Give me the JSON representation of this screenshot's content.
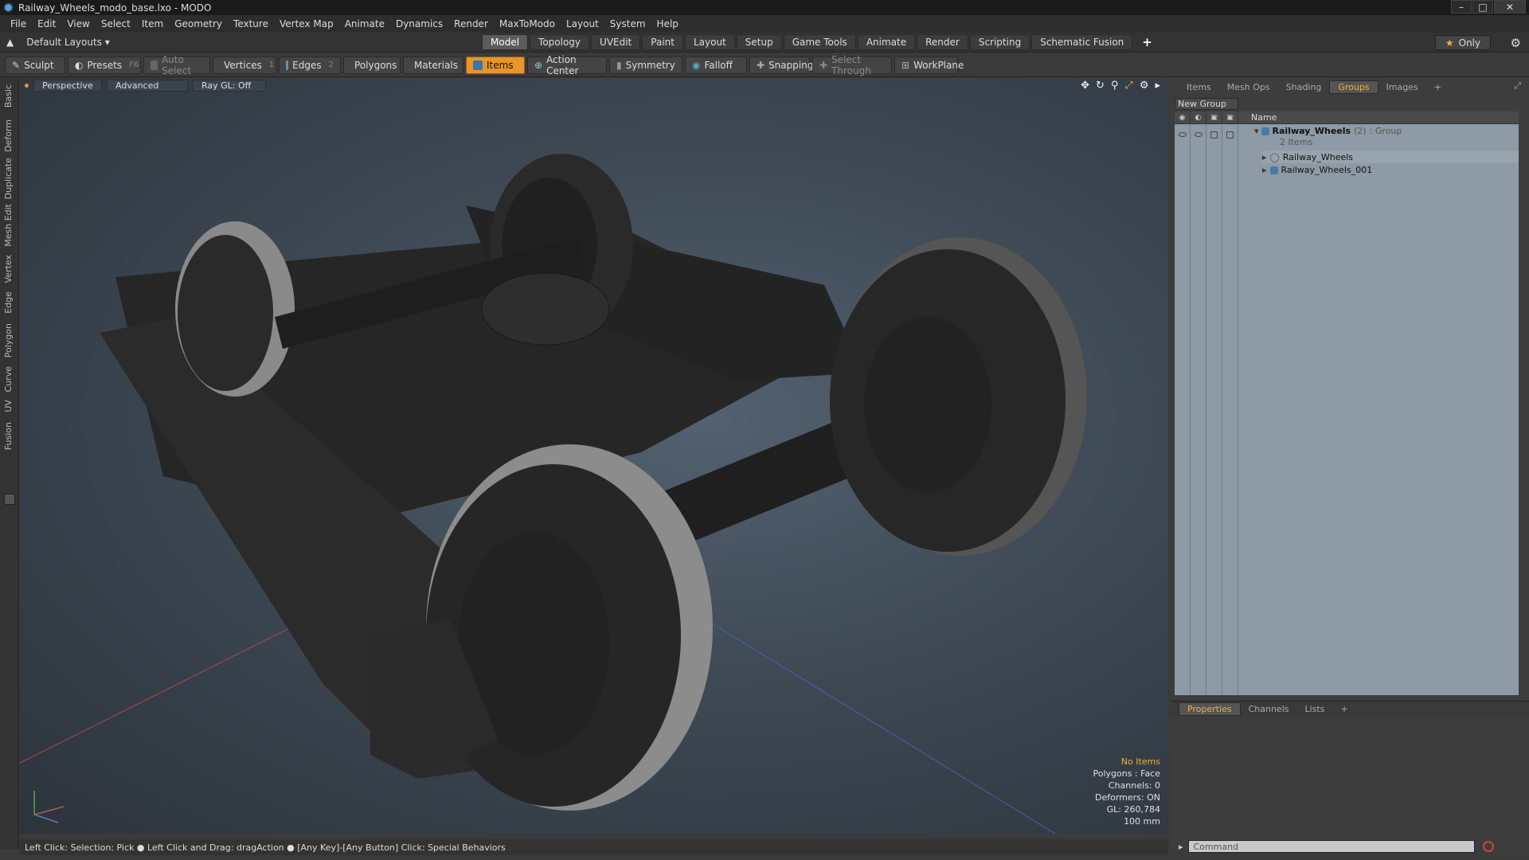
{
  "window": {
    "title": "Railway_Wheels_modo_base.lxo - MODO",
    "buttons": {
      "minimize": "–",
      "maximize": "□",
      "close": "✕"
    }
  },
  "menu": [
    "File",
    "Edit",
    "View",
    "Select",
    "Item",
    "Geometry",
    "Texture",
    "Vertex Map",
    "Animate",
    "Dynamics",
    "Render",
    "MaxToModo",
    "Layout",
    "System",
    "Help"
  ],
  "layout_bar": {
    "layouts_dropdown": "Default Layouts ▾",
    "tabs": [
      "Model",
      "Topology",
      "UVEdit",
      "Paint",
      "Layout",
      "Setup",
      "Game Tools",
      "Animate",
      "Render",
      "Scripting",
      "Schematic Fusion"
    ],
    "active_tab": "Model",
    "add_tab": "+",
    "only_label": "Only"
  },
  "toolbar": {
    "sculpt": "Sculpt",
    "presets": "Presets",
    "presets_key": "F6",
    "auto_select": "Auto Select",
    "vertices": "Vertices",
    "vertices_key": "1",
    "edges": "Edges",
    "edges_key": "2",
    "polygons": "Polygons",
    "materials": "Materials",
    "items": "Items",
    "action_center": "Action Center",
    "symmetry": "Symmetry",
    "falloff": "Falloff",
    "snapping": "Snapping",
    "select_through": "Select Through",
    "workplane": "WorkPlane"
  },
  "left_tabs": [
    "Basic",
    "Deform",
    "Duplicate",
    "Mesh Edit",
    "Vertex",
    "Edge",
    "Polygon",
    "Curve",
    "UV",
    "Fusion"
  ],
  "viewport": {
    "view_mode": "Perspective",
    "shading": "Advanced",
    "ray_gl": "Ray GL: Off",
    "info": {
      "selection": "No Items",
      "polygons": "Polygons : Face",
      "channels": "Channels: 0",
      "deformers": "Deformers: ON",
      "gl": "GL: 260,784",
      "scale": "100 mm"
    }
  },
  "statusbar": "Left Click: Selection: Pick ● Left Click and Drag: dragAction ● [Any Key]-[Any Button] Click: Special Behaviors",
  "right_panel": {
    "tabs": [
      "Items",
      "Mesh Ops",
      "Shading",
      "Groups",
      "Images"
    ],
    "active_tab": "Groups",
    "new_group": "New Group",
    "column_name": "Name",
    "group": {
      "name": "Railway_Wheels",
      "count": "(2)",
      "type": ": Group",
      "subtitle": "2 Items",
      "children": [
        "Railway_Wheels",
        "Railway_Wheels_001"
      ]
    },
    "props_tabs": [
      "Properties",
      "Channels",
      "Lists"
    ],
    "props_active": "Properties",
    "command_placeholder": "Command"
  }
}
